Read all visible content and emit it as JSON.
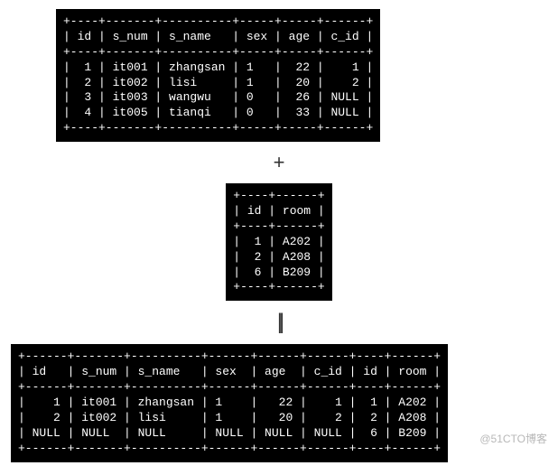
{
  "tables": {
    "students": {
      "columns": [
        "id",
        "s_num",
        "s_name",
        "sex",
        "age",
        "c_id"
      ],
      "rows": [
        {
          "id": "1",
          "s_num": "it001",
          "s_name": "zhangsan",
          "sex": "1",
          "age": "22",
          "c_id": "1"
        },
        {
          "id": "2",
          "s_num": "it002",
          "s_name": "lisi",
          "sex": "1",
          "age": "20",
          "c_id": "2"
        },
        {
          "id": "3",
          "s_num": "it003",
          "s_name": "wangwu",
          "sex": "0",
          "age": "26",
          "c_id": "NULL"
        },
        {
          "id": "4",
          "s_num": "it005",
          "s_name": "tianqi",
          "sex": "0",
          "age": "33",
          "c_id": "NULL"
        }
      ]
    },
    "rooms": {
      "columns": [
        "id",
        "room"
      ],
      "rows": [
        {
          "id": "1",
          "room": "A202"
        },
        {
          "id": "2",
          "room": "A208"
        },
        {
          "id": "6",
          "room": "B209"
        }
      ]
    },
    "joined": {
      "columns": [
        "id",
        "s_num",
        "s_name",
        "sex",
        "age",
        "c_id",
        "id",
        "room"
      ],
      "rows": [
        {
          "id1": "1",
          "s_num": "it001",
          "s_name": "zhangsan",
          "sex": "1",
          "age": "22",
          "c_id": "1",
          "id2": "1",
          "room": "A202"
        },
        {
          "id1": "2",
          "s_num": "it002",
          "s_name": "lisi",
          "sex": "1",
          "age": "20",
          "c_id": "2",
          "id2": "2",
          "room": "A208"
        },
        {
          "id1": "NULL",
          "s_num": "NULL",
          "s_name": "NULL",
          "sex": "NULL",
          "age": "NULL",
          "c_id": "NULL",
          "id2": "6",
          "room": "B209"
        }
      ]
    }
  },
  "operators": {
    "plus": "+",
    "equals": "||"
  },
  "watermark": "@51CTO博客"
}
